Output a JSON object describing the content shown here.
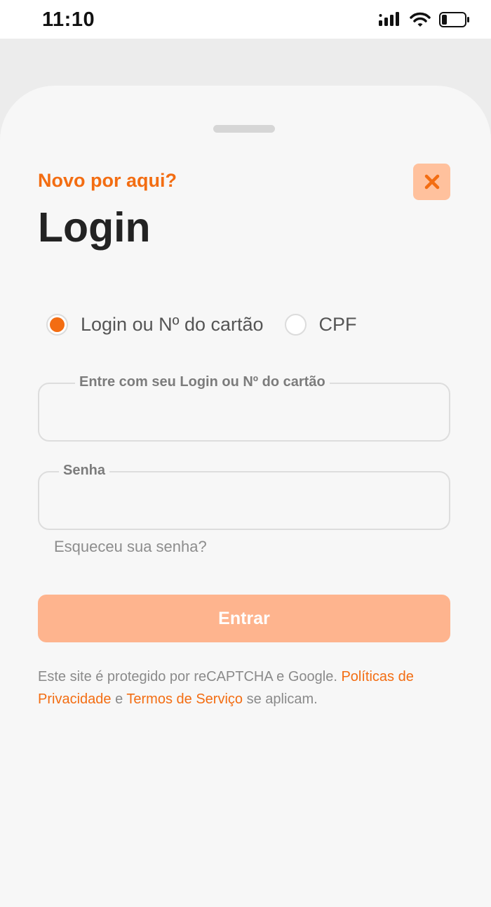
{
  "status_bar": {
    "time": "11:10"
  },
  "login_sheet": {
    "subtitle": "Novo por aqui?",
    "title": "Login",
    "close_icon": "close-icon",
    "login_type": {
      "options": [
        {
          "label": "Login ou Nº do cartão",
          "selected": true
        },
        {
          "label": "CPF",
          "selected": false
        }
      ]
    },
    "login_field": {
      "label": "Entre com seu Login ou Nº do cartão",
      "value": ""
    },
    "password_field": {
      "label": "Senha",
      "value": ""
    },
    "forgot_password": "Esqueceu sua senha?",
    "submit_label": "Entrar",
    "legal": {
      "text_1": "Este site é protegido por reCAPTCHA e Google. ",
      "privacy_link": "Políticas de Privacidade",
      "text_2": " e ",
      "terms_link": "Termos de Serviço",
      "text_3": " se aplicam."
    }
  },
  "colors": {
    "accent": "#f36d12",
    "button_disabled": "#feb48e",
    "close_bg": "#ffc19d",
    "sheet_bg": "#f7f7f7"
  }
}
